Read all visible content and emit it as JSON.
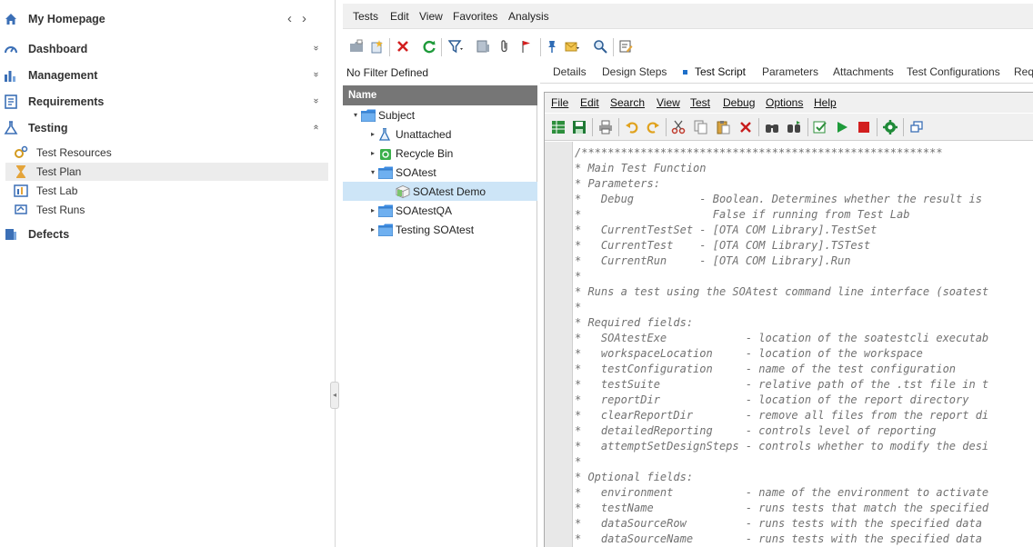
{
  "nav": {
    "home": "My Homepage",
    "sections": [
      {
        "label": "Dashboard",
        "chevron": "»"
      },
      {
        "label": "Management",
        "chevron": "»"
      },
      {
        "label": "Requirements",
        "chevron": "»"
      },
      {
        "label": "Testing",
        "chevron": "«"
      }
    ],
    "testing_items": [
      "Test Resources",
      "Test Plan",
      "Test Lab",
      "Test Runs"
    ],
    "defects": "Defects",
    "prev": "‹",
    "next": "›"
  },
  "menu": [
    "Tests",
    "Edit",
    "View",
    "Favorites",
    "Analysis"
  ],
  "filter_text": "No Filter Defined",
  "tree": {
    "header": "Name",
    "nodes": [
      {
        "label": "Subject",
        "twisty": "▾"
      },
      {
        "label": "Unattached",
        "twisty": "▸"
      },
      {
        "label": "Recycle Bin",
        "twisty": "▸"
      },
      {
        "label": "SOAtest",
        "twisty": "▾"
      },
      {
        "label": "SOAtest Demo",
        "twisty": ""
      },
      {
        "label": "SOAtestQA",
        "twisty": "▸"
      },
      {
        "label": "Testing SOAtest",
        "twisty": "▸"
      }
    ]
  },
  "tabs": [
    "Details",
    "Design Steps",
    "Test Script",
    "Parameters",
    "Attachments",
    "Test Configurations",
    "Req"
  ],
  "editor_menu": [
    "File",
    "Edit",
    "Search",
    "View",
    "Test",
    "Debug",
    "Options",
    "Help"
  ],
  "code_lines": [
    "/*******************************************************",
    "* Main Test Function",
    "* Parameters:",
    "*   Debug          - Boolean. Determines whether the result is",
    "*                    False if running from Test Lab",
    "*   CurrentTestSet - [OTA COM Library].TestSet",
    "*   CurrentTest    - [OTA COM Library].TSTest",
    "*   CurrentRun     - [OTA COM Library].Run",
    "*",
    "* Runs a test using the SOAtest command line interface (soatest",
    "*",
    "* Required fields:",
    "*   SOAtestExe            - location of the soatestcli executab",
    "*   workspaceLocation     - location of the workspace",
    "*   testConfiguration     - name of the test configuration",
    "*   testSuite             - relative path of the .tst file in t",
    "*   reportDir             - location of the report directory",
    "*   clearReportDir        - remove all files from the report di",
    "*   detailedReporting     - controls level of reporting",
    "*   attemptSetDesignSteps - controls whether to modify the desi",
    "*",
    "* Optional fields:",
    "*   environment           - name of the environment to activate",
    "*   testName              - runs tests that match the specified",
    "*   dataSourceRow         - runs tests with the specified data",
    "*   dataSourceName        - runs tests with the specified data"
  ]
}
